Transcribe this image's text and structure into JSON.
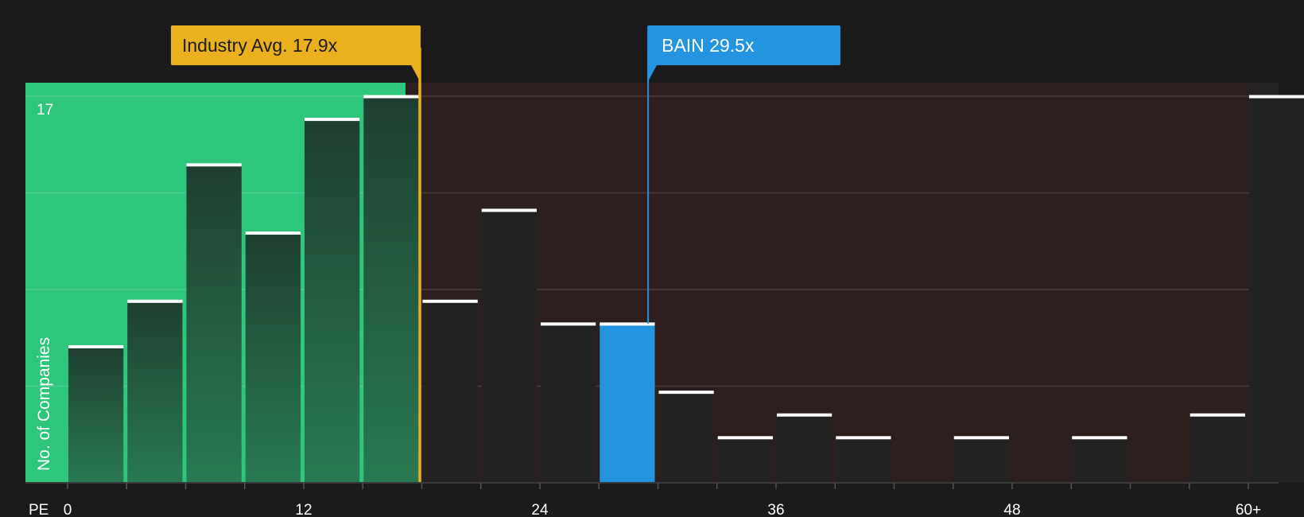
{
  "chart_data": {
    "type": "bar",
    "x_axis_label": "PE",
    "y_axis_label": "No. of Companies",
    "y_max_label": "17",
    "ylim": [
      0,
      17
    ],
    "x_ticks": [
      "0",
      "12",
      "24",
      "36",
      "48",
      "60+"
    ],
    "bins": [
      {
        "start": 0,
        "end": 3,
        "count": 6
      },
      {
        "start": 3,
        "end": 6,
        "count": 8
      },
      {
        "start": 6,
        "end": 9,
        "count": 14
      },
      {
        "start": 9,
        "end": 12,
        "count": 11
      },
      {
        "start": 12,
        "end": 15,
        "count": 16
      },
      {
        "start": 15,
        "end": 18,
        "count": 17
      },
      {
        "start": 18,
        "end": 21,
        "count": 8
      },
      {
        "start": 21,
        "end": 24,
        "count": 12
      },
      {
        "start": 24,
        "end": 27,
        "count": 7
      },
      {
        "start": 27,
        "end": 30,
        "count": 7,
        "highlight": true
      },
      {
        "start": 30,
        "end": 33,
        "count": 4
      },
      {
        "start": 33,
        "end": 36,
        "count": 2
      },
      {
        "start": 36,
        "end": 39,
        "count": 3
      },
      {
        "start": 39,
        "end": 42,
        "count": 2
      },
      {
        "start": 42,
        "end": 45,
        "count": 0
      },
      {
        "start": 45,
        "end": 48,
        "count": 2
      },
      {
        "start": 48,
        "end": 51,
        "count": 0
      },
      {
        "start": 51,
        "end": 54,
        "count": 2
      },
      {
        "start": 54,
        "end": 57,
        "count": 0
      },
      {
        "start": 57,
        "end": 60,
        "count": 3
      },
      {
        "start": 60,
        "end": 63,
        "count": 17
      }
    ],
    "industry_avg": {
      "label": "Industry Avg. 17.9x",
      "value": 17.9
    },
    "company": {
      "label": "BAIN 29.5x",
      "value": 29.5
    },
    "colors": {
      "background": "#1b1b1b",
      "undervalued_zone": "#2ec67b",
      "overvalued_zone": "#2e1f1f",
      "bar_dark": "#222222",
      "bar_highlight": "#2394e0",
      "industry_avg": "#eab01e",
      "company": "#2394e0",
      "bar_cap": "#ffffff"
    }
  }
}
